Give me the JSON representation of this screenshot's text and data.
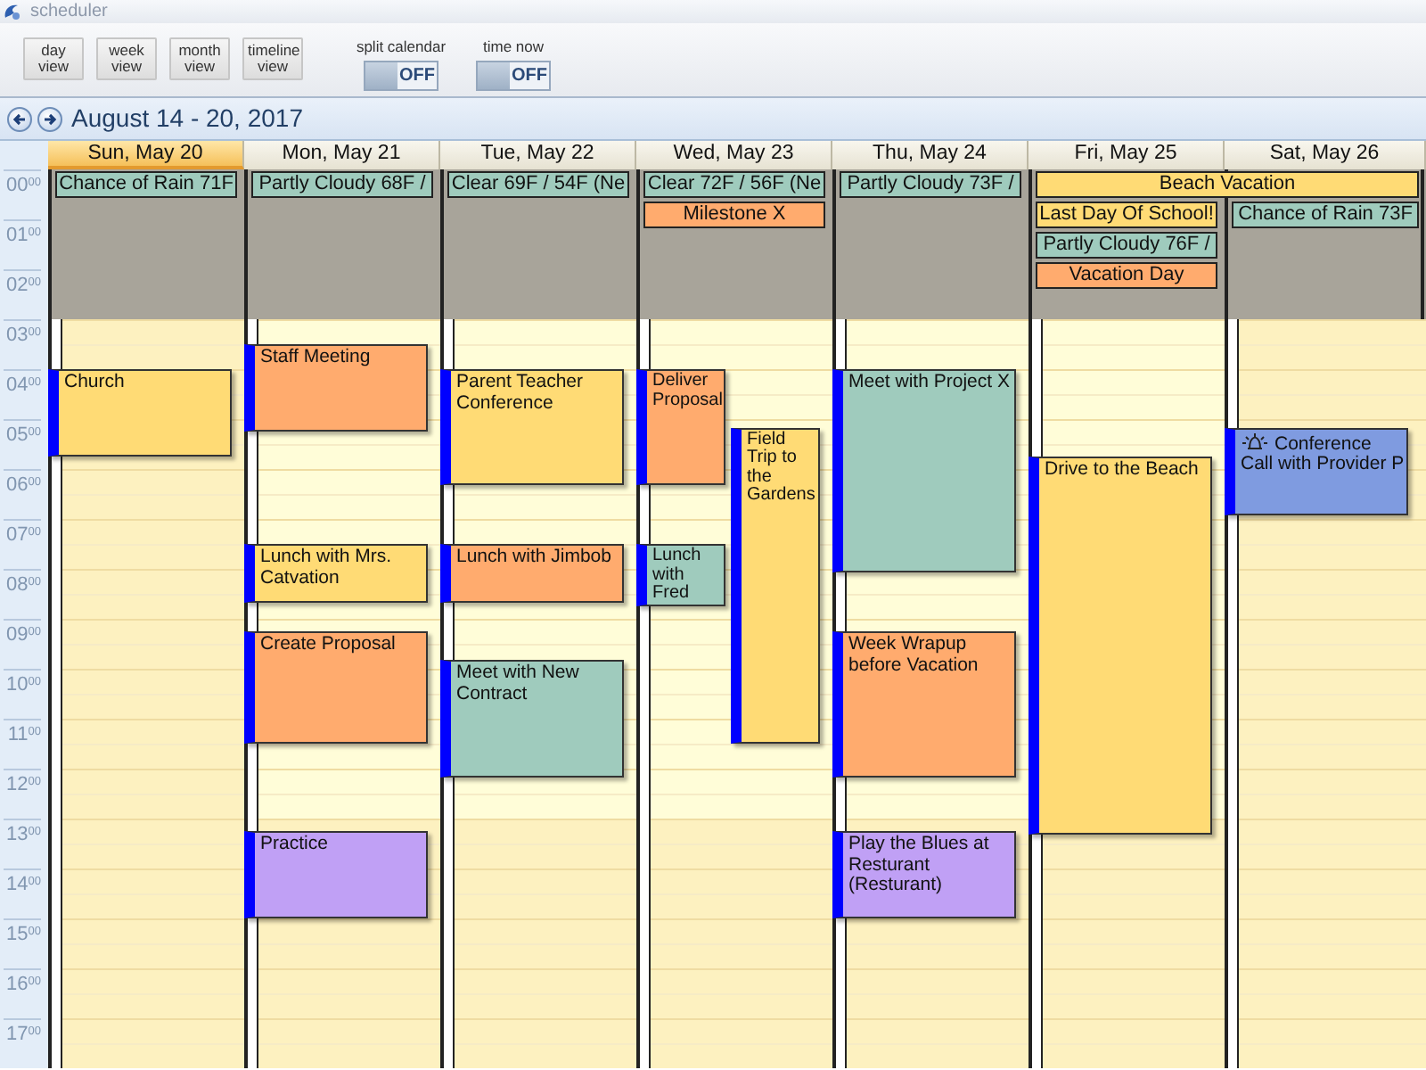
{
  "window": {
    "title": "scheduler"
  },
  "toolbar": {
    "view_buttons": [
      "day view",
      "week view",
      "month view",
      "timeline view"
    ],
    "toggles": [
      {
        "label": "split calendar",
        "state_text": "OFF",
        "on": false
      },
      {
        "label": "time now",
        "state_text": "OFF",
        "on": false
      }
    ]
  },
  "navigation": {
    "range": "August 14 - 20, 2017"
  },
  "hours": [
    "00$^{00}$",
    "01$^{00}$",
    "02$^{00}$",
    "03$^{00}$",
    "04$^{00}$",
    "05$^{00}$",
    "06$^{00}$",
    "07$^{00}$",
    "08$^{00}$",
    "09$^{00}$",
    "10$^{00}$",
    "11$^{00}$",
    "12$^{00}$",
    "13$^{00}$",
    "14$^{00}$",
    "15$^{00}$",
    "16$^{00}$",
    "17$^{00}$"
  ],
  "days": [
    {
      "header": "Sun, May 20",
      "selected": true,
      "weekend": true,
      "all_day": [
        {
          "title": "Chance of Rain 71F",
          "color": "#9fcbbd",
          "spans_next_day": false
        }
      ],
      "events": [
        {
          "title": "Church",
          "color": "#ffdb75",
          "reminder": false
        }
      ]
    },
    {
      "header": "Mon, May 21",
      "selected": false,
      "weekend": false,
      "all_day": [
        {
          "title": "Partly Cloudy 68F /",
          "color": "#9fcbbd",
          "spans_next_day": false
        }
      ],
      "events": [
        {
          "title": "Staff Meeting",
          "color": "#ffab6e",
          "reminder": false
        },
        {
          "title": "Lunch with Mrs. Catvation",
          "color": "#ffdb75",
          "reminder": false
        },
        {
          "title": "Create Proposal",
          "color": "#ffab6e",
          "reminder": false
        },
        {
          "title": "Practice",
          "color": "#c0a0f5",
          "reminder": false
        }
      ]
    },
    {
      "header": "Tue, May 22",
      "selected": false,
      "weekend": false,
      "all_day": [
        {
          "title": "Clear 69F / 54F (Ne",
          "color": "#9fcbbd",
          "spans_next_day": false
        }
      ],
      "events": [
        {
          "title": "Parent Teacher Conference",
          "color": "#ffdb75",
          "reminder": false
        },
        {
          "title": "Lunch with Jimbob",
          "color": "#ffab6e",
          "reminder": false
        },
        {
          "title": "Meet with New Contract",
          "color": "#9fcbbd",
          "reminder": false
        }
      ]
    },
    {
      "header": "Wed, May 23",
      "selected": false,
      "weekend": false,
      "all_day": [
        {
          "title": "Clear 72F / 56F (Ne",
          "color": "#9fcbbd",
          "spans_next_day": false
        },
        {
          "title": "Milestone X",
          "color": "#ffab6e",
          "spans_next_day": false
        }
      ],
      "events": [
        {
          "title": "Deliver Proposal",
          "color": "#ffab6e",
          "reminder": false
        },
        {
          "title": "Field Trip to the Gardens",
          "color": "#ffdb75",
          "reminder": false
        },
        {
          "title": "Lunch with Fred",
          "color": "#9fcbbd",
          "reminder": false
        }
      ]
    },
    {
      "header": "Thu, May 24",
      "selected": false,
      "weekend": false,
      "all_day": [
        {
          "title": "Partly Cloudy 73F /",
          "color": "#9fcbbd",
          "spans_next_day": false
        }
      ],
      "events": [
        {
          "title": "Meet with Project X",
          "color": "#9fcbbd",
          "reminder": false
        },
        {
          "title": "Week Wrapup before Vacation",
          "color": "#ffab6e",
          "reminder": false
        },
        {
          "title": "Play the Blues at Resturant (Resturant)",
          "color": "#c0a0f5",
          "reminder": false
        }
      ]
    },
    {
      "header": "Fri, May 25",
      "selected": false,
      "weekend": false,
      "all_day": [
        {
          "title": "Beach Vacation",
          "color": "#ffdb75",
          "spans_next_day": true
        },
        {
          "title": "Last Day Of School!",
          "color": "#ffdb75",
          "spans_next_day": false
        },
        {
          "title": "Partly Cloudy 76F /",
          "color": "#9fcbbd",
          "spans_next_day": false
        },
        {
          "title": "Vacation Day",
          "color": "#ffab6e",
          "spans_next_day": false
        }
      ],
      "events": [
        {
          "title": "Drive to the Beach",
          "color": "#ffdb75",
          "reminder": false
        }
      ]
    },
    {
      "header": "Sat, May 26",
      "selected": false,
      "weekend": true,
      "all_day": [
        {
          "title": "Chance of Rain 73F",
          "color": "#9fcbbd",
          "spans_next_day": false
        }
      ],
      "events": [
        {
          "title": "Conference Call with Provider P",
          "color": "#7f9be0",
          "reminder": true
        }
      ]
    }
  ]
}
